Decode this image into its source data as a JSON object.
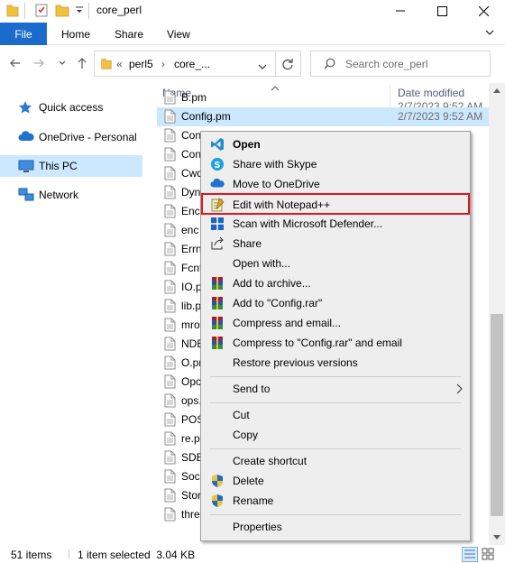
{
  "window": {
    "title": "core_perl"
  },
  "ribbon": {
    "file": "File",
    "home": "Home",
    "share": "Share",
    "view": "View"
  },
  "address": {
    "overflow": "«",
    "crumbs": [
      "perl5",
      "core_..."
    ]
  },
  "search": {
    "placeholder": "Search core_perl"
  },
  "nav": {
    "items": [
      "Quick access",
      "OneDrive - Personal",
      "This PC",
      "Network"
    ],
    "selected": "This PC"
  },
  "columns": {
    "name": "Name",
    "date": "Date modified"
  },
  "files": [
    {
      "name": "B.pm",
      "date": ""
    },
    {
      "name": "Config.pm",
      "date": "2/7/2023 9:52 AM"
    },
    {
      "name": "Con",
      "date": ""
    },
    {
      "name": "Con",
      "date": ""
    },
    {
      "name": "Cwd",
      "date": ""
    },
    {
      "name": "Dyn",
      "date": ""
    },
    {
      "name": "Enc",
      "date": ""
    },
    {
      "name": "enc",
      "date": ""
    },
    {
      "name": "Errn",
      "date": ""
    },
    {
      "name": "Fcnt",
      "date": ""
    },
    {
      "name": "IO.p",
      "date": ""
    },
    {
      "name": "lib.p",
      "date": ""
    },
    {
      "name": "mro",
      "date": ""
    },
    {
      "name": "NDB",
      "date": ""
    },
    {
      "name": "O.pr",
      "date": ""
    },
    {
      "name": "Opc",
      "date": ""
    },
    {
      "name": "ops.",
      "date": ""
    },
    {
      "name": "POS",
      "date": ""
    },
    {
      "name": "re.p",
      "date": ""
    },
    {
      "name": "SDB",
      "date": ""
    },
    {
      "name": "Sock",
      "date": ""
    },
    {
      "name": "Stor",
      "date": ""
    },
    {
      "name": "thre",
      "date": ""
    }
  ],
  "first_row_date": "2/7/2023 9:52 AM",
  "status": {
    "items": "51 items",
    "selected": "1 item selected  3.04 KB"
  },
  "context_menu": {
    "open": "Open",
    "share_skype": "Share with Skype",
    "move_onedrive": "Move to OneDrive",
    "edit_notepad": "Edit with Notepad++",
    "scan_defender": "Scan with Microsoft Defender...",
    "share": "Share",
    "open_with": "Open with...",
    "add_archive": "Add to archive...",
    "add_rar": "Add to \"Config.rar\"",
    "compress_email": "Compress and email...",
    "compress_rar_email": "Compress to \"Config.rar\" and email",
    "restore_versions": "Restore previous versions",
    "send_to": "Send to",
    "cut": "Cut",
    "copy": "Copy",
    "create_shortcut": "Create shortcut",
    "delete": "Delete",
    "rename": "Rename",
    "properties": "Properties"
  },
  "colors": {
    "accent": "#1a6bcb",
    "selection": "#cce8ff",
    "highlight_border": "#e8121e"
  }
}
